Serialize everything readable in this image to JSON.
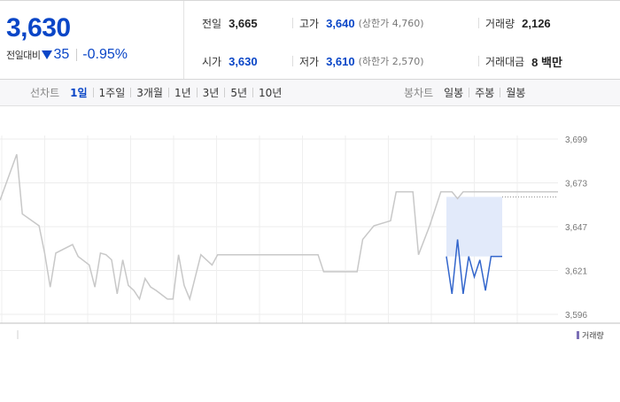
{
  "quote": {
    "price": "3,630",
    "change_label": "전일대비",
    "change_direction_icon": "down-triangle-icon",
    "change_value": "35",
    "change_rate": "-0.95%",
    "colors": {
      "down": "#0a46c7",
      "up": "#d60000"
    }
  },
  "info": {
    "prev_close": {
      "label": "전일",
      "value": "3,665"
    },
    "high": {
      "label": "고가",
      "value": "3,640",
      "sub": "(상한가 4,760)"
    },
    "volume": {
      "label": "거래량",
      "value": "2,126"
    },
    "open": {
      "label": "시가",
      "value": "3,630"
    },
    "low": {
      "label": "저가",
      "value": "3,610",
      "sub": "(하한가 2,570)"
    },
    "amount": {
      "label": "거래대금",
      "value": "8 백만"
    }
  },
  "tabs": {
    "line_title": "선차트",
    "line_periods": [
      "1일",
      "1주일",
      "3개월",
      "1년",
      "3년",
      "5년",
      "10년"
    ],
    "line_active": "1일",
    "candle_title": "봉차트",
    "candle_periods": [
      "일봉",
      "주봉",
      "월봉"
    ]
  },
  "chart_data": {
    "type": "line",
    "y_ticks": [
      "3,699",
      "3,673",
      "3,647",
      "3,621",
      "3,596"
    ],
    "ylim": [
      3596,
      3699
    ],
    "grid": true,
    "reference_line": {
      "value": 3665
    },
    "legend": {
      "label": "거래량",
      "placement": "bottom-right"
    },
    "series": [
      {
        "color": "#c8c8c8",
        "x": [
          0,
          3,
          4,
          7,
          8,
          9,
          10,
          13,
          14,
          16,
          17,
          18,
          19,
          20,
          21,
          22,
          23,
          24,
          25,
          26,
          27,
          28,
          30,
          31,
          32,
          33,
          34,
          36,
          38,
          39,
          40,
          41,
          42,
          44,
          48,
          52,
          54,
          56,
          57,
          58,
          60,
          62,
          63,
          64,
          65,
          67,
          70,
          71,
          72,
          74,
          75,
          77,
          79,
          80,
          81,
          82,
          83,
          84,
          88,
          90,
          91,
          92,
          93,
          94,
          95,
          96,
          100
        ],
        "values": [
          3663,
          3690,
          3655,
          3648,
          3632,
          3612,
          3632,
          3637,
          3630,
          3625,
          3612,
          3632,
          3631,
          3628,
          3608,
          3628,
          3613,
          3610,
          3605,
          3617,
          3612,
          3610,
          3605,
          3605,
          3631,
          3613,
          3605,
          3631,
          3625,
          3631,
          3631,
          3631,
          3631,
          3631,
          3631,
          3631,
          3631,
          3631,
          3631,
          3621,
          3621,
          3621,
          3621,
          3621,
          3640,
          3648,
          3651,
          3668,
          3668,
          3668,
          3631,
          3648,
          3668,
          3668,
          3668,
          3664,
          3668,
          3668,
          3668,
          3668,
          3668,
          3668,
          3668,
          3668,
          3668,
          3668,
          3668
        ]
      },
      {
        "color": "#3366cc",
        "x": [
          80,
          81,
          82,
          83,
          84,
          85,
          86,
          87,
          88,
          89,
          90
        ],
        "values": [
          3630,
          3608,
          3640,
          3608,
          3630,
          3618,
          3628,
          3610,
          3630,
          3630,
          3630
        ]
      }
    ]
  }
}
